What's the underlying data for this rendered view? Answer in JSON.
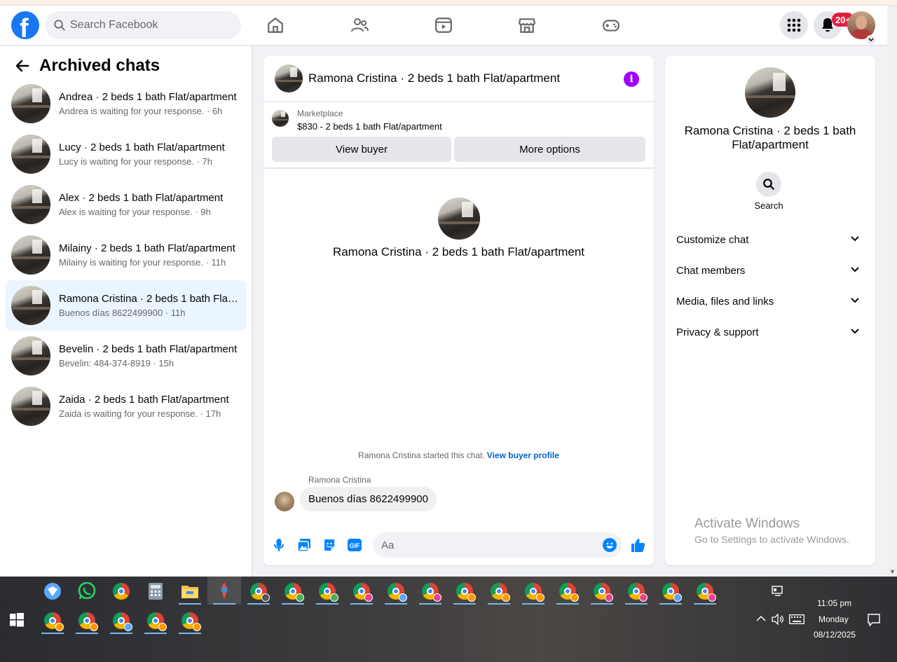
{
  "header": {
    "search_placeholder": "Search Facebook",
    "notif_badge": "20+",
    "nav_icons": [
      "home-icon",
      "friends-icon",
      "video-icon",
      "marketplace-icon",
      "gaming-icon"
    ]
  },
  "sidebar": {
    "title": "Archived chats",
    "chats": [
      {
        "name": "Andrea · 2 beds 1 bath Flat/apartment",
        "sub": "Andrea is waiting for your response. · 6h"
      },
      {
        "name": "Lucy · 2 beds 1 bath Flat/apartment",
        "sub": "Lucy is waiting for your response. · 7h"
      },
      {
        "name": "Alex · 2 beds 1 bath Flat/apartment",
        "sub": "Alex is waiting for your response. · 9h"
      },
      {
        "name": "Milainy · 2 beds 1 bath Flat/apartment",
        "sub": "Milainy is waiting for your response. · 11h"
      },
      {
        "name": "Ramona Cristina · 2 beds 1 bath Flat/apartment",
        "sub": "Buenos días 8622499900 · 11h"
      },
      {
        "name": "Bevelin · 2 beds 1 bath Flat/apartment",
        "sub": "Bevelin: 484-374-8919 · 15h"
      },
      {
        "name": "Zaida · 2 beds 1 bath Flat/apartment",
        "sub": "Zaida is waiting for your response. · 17h"
      }
    ]
  },
  "conversation": {
    "title": "Ramona Cristina · 2 beds 1 bath Flat/apartment",
    "marketplace_label": "Marketplace",
    "listing": "$830 - 2 beds 1 bath Flat/apartment",
    "view_buyer_label": "View buyer",
    "more_options_label": "More options",
    "intro_name": "Ramona Cristina · 2 beds 1 bath Flat/apartment",
    "started_text": "Ramona Cristina started this chat.",
    "view_buyer_profile": "View buyer profile",
    "sender": "Ramona Cristina",
    "message": "Buenos días 8622499900",
    "composer_placeholder": "Aa"
  },
  "details": {
    "name": "Ramona Cristina · 2 beds 1 bath Flat/apartment",
    "search_label": "Search",
    "sections": [
      "Customize chat",
      "Chat members",
      "Media, files and links",
      "Privacy & support"
    ]
  },
  "watermark": {
    "line1": "Activate Windows",
    "line2": "Go to Settings to activate Windows."
  },
  "taskbar": {
    "time": "11:05 pm",
    "day": "Monday",
    "date": "08/12/2025"
  },
  "colors": {
    "brand": "#1877f2",
    "active_chat_bg": "#ebf5ff",
    "info_purple": "#a100ff",
    "link_blue": "#0064d1"
  }
}
